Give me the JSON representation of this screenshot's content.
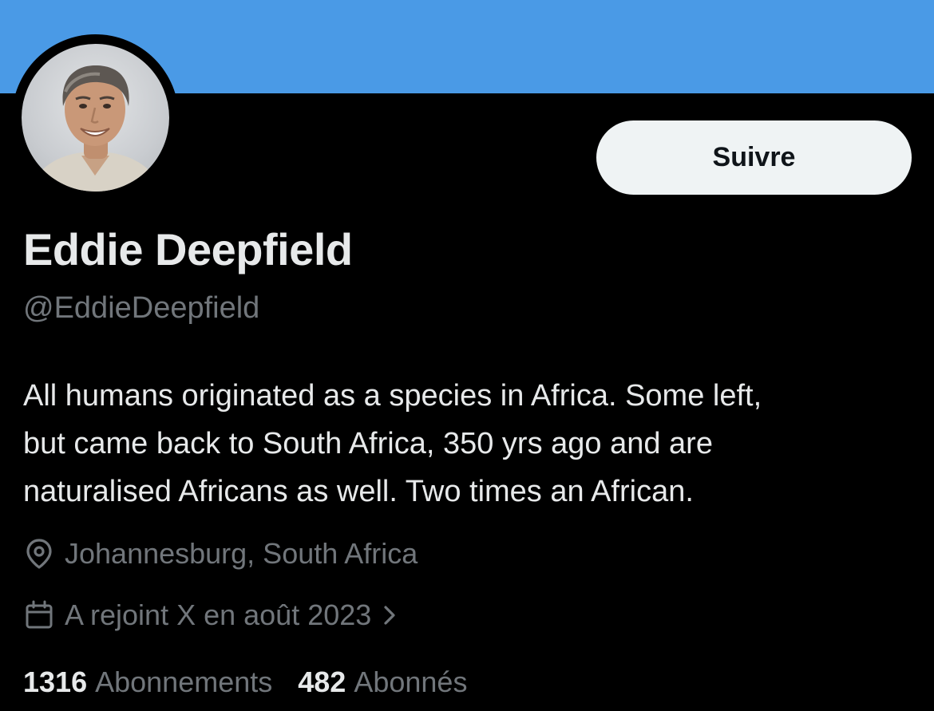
{
  "colors": {
    "banner": "#4a9ae6",
    "background": "#000000",
    "primary_text": "#e7e9ea",
    "secondary_text": "#71767b",
    "button_bg": "#eff3f4",
    "button_text": "#0f1419"
  },
  "profile": {
    "display_name": "Eddie Deepfield",
    "handle": "@EddieDeepfield",
    "bio_lines": [
      "All humans originated as a species in Africa. Some left,",
      "but came back to South Africa, 350 yrs ago and are",
      "naturalised Africans as well. Two times an African."
    ],
    "location": "Johannesburg, South Africa",
    "location_icon": "location-pin-icon",
    "joined": "A rejoint X en août 2023",
    "joined_icon": "calendar-icon"
  },
  "actions": {
    "follow_label": "Suivre"
  },
  "stats": {
    "following_count": "1316",
    "following_label": "Abonnements",
    "followers_count": "482",
    "followers_label": "Abonnés"
  }
}
